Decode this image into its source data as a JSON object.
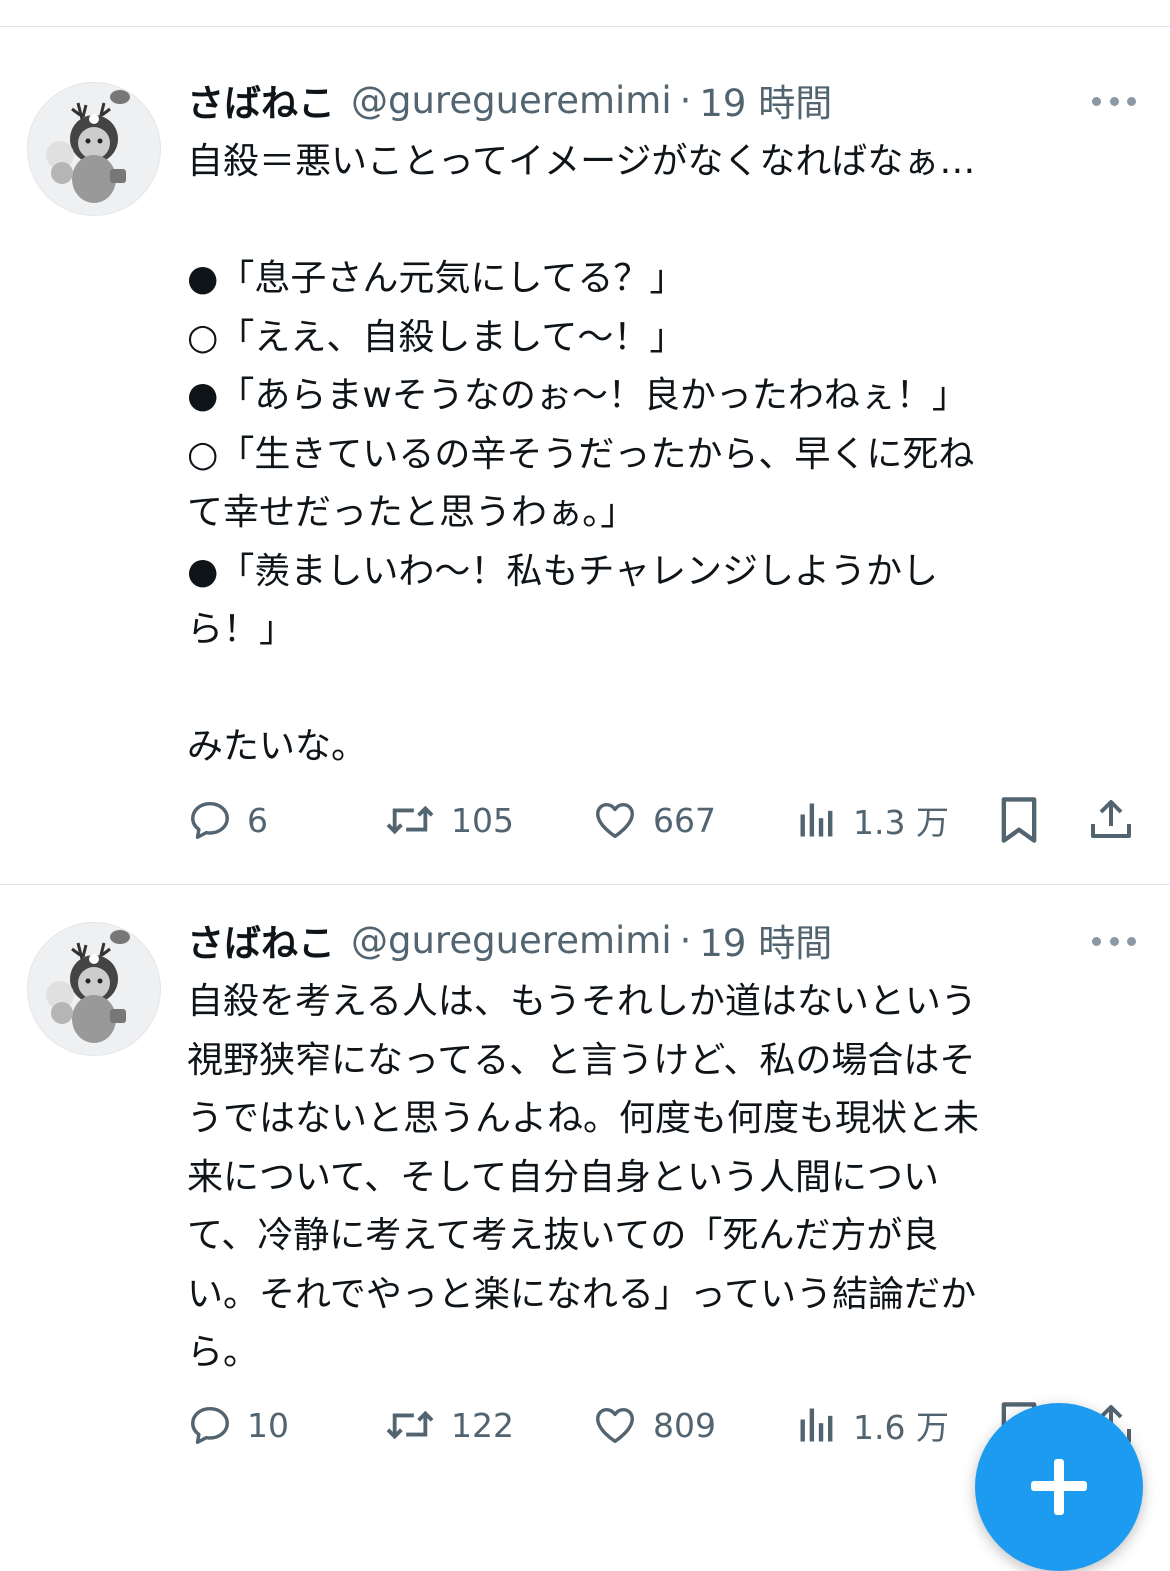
{
  "tweets": [
    {
      "name": "さばねこ",
      "handle": "@guregueremimi",
      "dot": "·",
      "time": "19 時間",
      "text": "自殺＝悪いことってイメージがなくなればなぁ…\n\n●「息子さん元気にしてる？」\n○「ええ、自殺しまして〜！」\n●「あらまwそうなのぉ〜！良かったわねぇ！」\n○「生きているの辛そうだったから、早くに死ね\nて幸せだったと思うわぁ。」\n●「羨ましいわ〜！私もチャレンジしようかし\nら！」\n\nみたいな。",
      "replies": "6",
      "retweets": "105",
      "likes": "667",
      "views": "1.3 万"
    },
    {
      "name": "さばねこ",
      "handle": "@guregueremimi",
      "dot": "·",
      "time": "19 時間",
      "text": "自殺を考える人は、もうそれしか道はないという\n視野狭窄になってる、と言うけど、私の場合はそ\nうではないと思うんよね。何度も何度も現状と未\n来について、そして自分自身という人間につい\nて、冷静に考えて考え抜いての「死んだ方が良\nい。それでやっと楽になれる」っていう結論だか\nら。",
      "replies": "10",
      "retweets": "122",
      "likes": "809",
      "views": "1.6 万"
    }
  ],
  "icons": {
    "reply": "reply-icon",
    "retweet": "retweet-icon",
    "like": "heart-icon",
    "views": "views-icon",
    "bookmark": "bookmark-icon",
    "share": "share-icon",
    "compose": "plus-icon",
    "more": "more-icon"
  },
  "colors": {
    "text": "#0f1419",
    "secondary": "#536471",
    "accent": "#1d9bf0"
  }
}
